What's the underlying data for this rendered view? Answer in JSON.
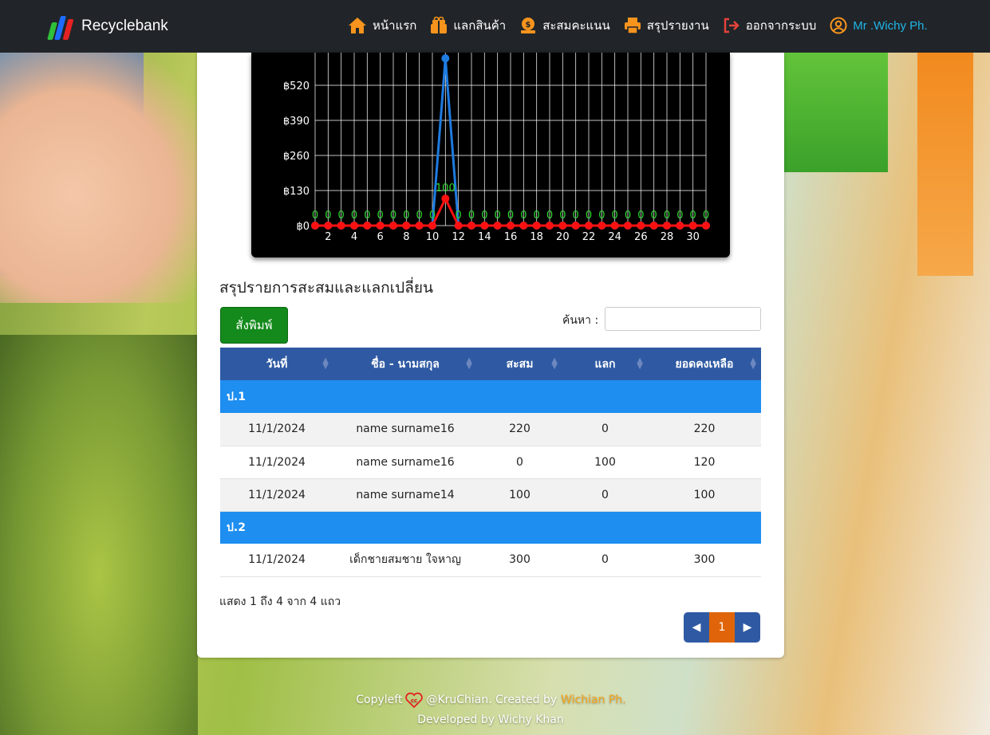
{
  "navbar": {
    "brand": "Recyclebank",
    "items": [
      {
        "label": "หน้าแรก",
        "icon": "home-icon"
      },
      {
        "label": "แลกสินค้า",
        "icon": "gift-icon"
      },
      {
        "label": "สะสมคะแนน",
        "icon": "coin-icon"
      },
      {
        "label": "สรุปรายงาน",
        "icon": "printer-icon"
      },
      {
        "label": "ออกจากระบบ",
        "icon": "logout-icon"
      }
    ],
    "user": "Mr .Wichy Ph."
  },
  "chart_data": {
    "type": "line",
    "x": [
      1,
      2,
      3,
      4,
      5,
      6,
      7,
      8,
      9,
      10,
      11,
      12,
      13,
      14,
      15,
      16,
      17,
      18,
      19,
      20,
      21,
      22,
      23,
      24,
      25,
      26,
      27,
      28,
      29,
      30,
      31
    ],
    "x_ticks": [
      "2",
      "4",
      "6",
      "8",
      "10",
      "12",
      "14",
      "16",
      "18",
      "20",
      "22",
      "24",
      "26",
      "28",
      "30"
    ],
    "y_ticks": [
      "฿0",
      "฿130",
      "฿260",
      "฿390",
      "฿520"
    ],
    "ylim": [
      0,
      650
    ],
    "series": [
      {
        "color": "#1e7be0",
        "values": [
          0,
          0,
          0,
          0,
          0,
          0,
          0,
          0,
          0,
          0,
          620,
          0,
          0,
          0,
          0,
          0,
          0,
          0,
          0,
          0,
          0,
          0,
          0,
          0,
          0,
          0,
          0,
          0,
          0,
          0,
          0
        ]
      },
      {
        "color": "#ff1010",
        "values": [
          0,
          0,
          0,
          0,
          0,
          0,
          0,
          0,
          0,
          0,
          100,
          0,
          0,
          0,
          0,
          0,
          0,
          0,
          0,
          0,
          0,
          0,
          0,
          0,
          0,
          0,
          0,
          0,
          0,
          0,
          0
        ],
        "labels": [
          "0",
          "0",
          "0",
          "0",
          "0",
          "0",
          "0",
          "0",
          "0",
          "0",
          "100",
          "0",
          "0",
          "0",
          "0",
          "0",
          "0",
          "0",
          "0",
          "0",
          "0",
          "0",
          "0",
          "0",
          "0",
          "0",
          "0",
          "0",
          "0",
          "0",
          "0"
        ]
      }
    ],
    "label_color": "#2fd82f"
  },
  "report": {
    "title": "สรุปรายการสะสมและแลกเปลี่ยน",
    "print_label": "สั่งพิมพ์",
    "search_label": "ค้นหา :",
    "search_value": "",
    "columns": [
      "วันที่",
      "ชื่อ - นามสกุล",
      "สะสม",
      "แลก",
      "ยอดคงเหลือ"
    ],
    "groups": [
      {
        "name": "ป.1",
        "rows": [
          [
            "11/1/2024",
            "name surname16",
            "220",
            "0",
            "220"
          ],
          [
            "11/1/2024",
            "name surname16",
            "0",
            "100",
            "120"
          ],
          [
            "11/1/2024",
            "name surname14",
            "100",
            "0",
            "100"
          ]
        ]
      },
      {
        "name": "ป.2",
        "rows": [
          [
            "11/1/2024",
            "เด็กชายสมชาย ใจหาญ",
            "300",
            "0",
            "300"
          ]
        ]
      }
    ],
    "info": "แสดง 1 ถึง 4 จาก 4 แถว",
    "page": "1"
  },
  "footer": {
    "copyleft": "Copyleft",
    "author": "@KruChian. Created by",
    "creator": "Wichian Ph.",
    "developed": "Developed by Wichy Khan"
  }
}
